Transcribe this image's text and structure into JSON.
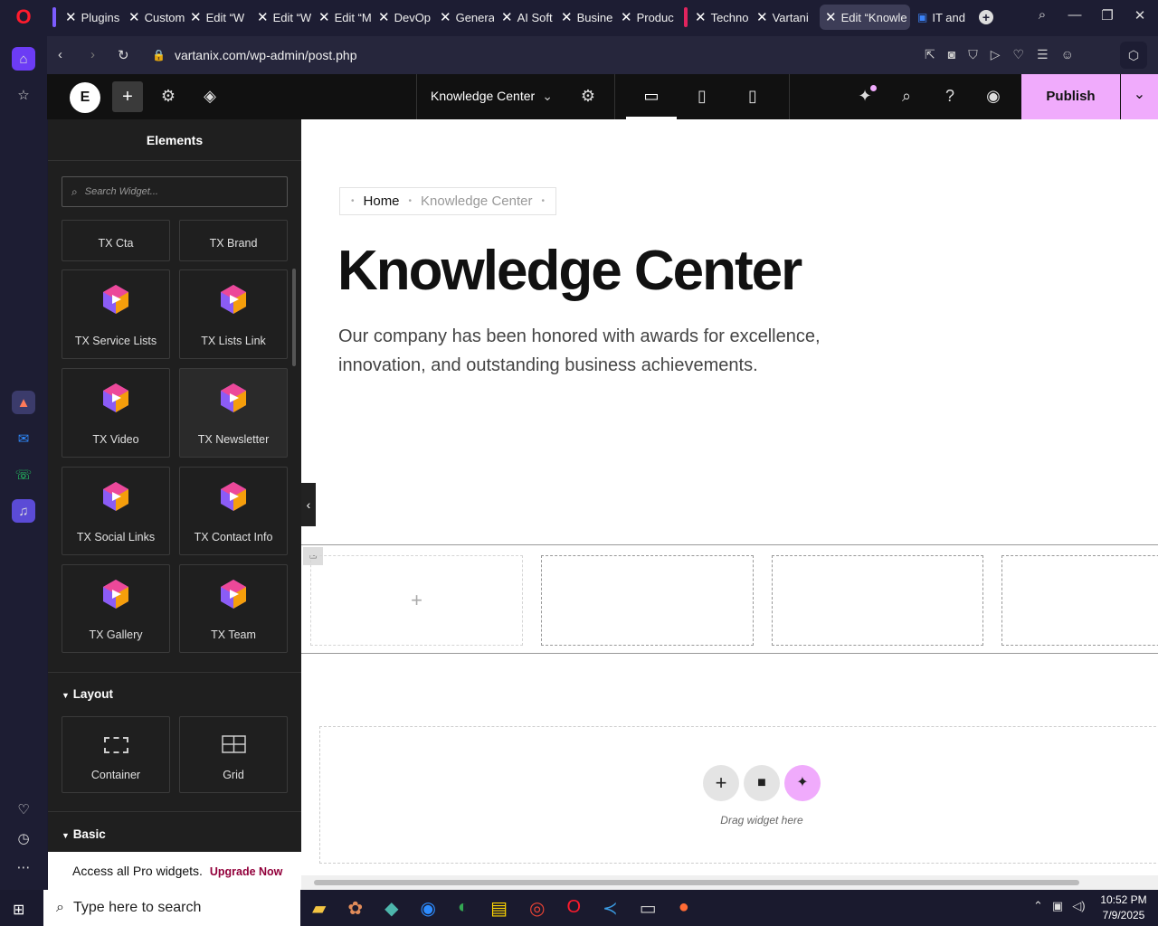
{
  "browser": {
    "tabs": [
      {
        "label": "Plugins"
      },
      {
        "label": "Custom"
      },
      {
        "label": "Edit “W"
      },
      {
        "label": "Edit “W"
      },
      {
        "label": "Edit “M"
      },
      {
        "label": "DevOp"
      },
      {
        "label": "Genera"
      },
      {
        "label": "AI Soft"
      },
      {
        "label": "Busine"
      },
      {
        "label": "Produc"
      },
      {
        "label": "Techno"
      },
      {
        "label": "Vartani"
      },
      {
        "label": "Edit “Knowle"
      },
      {
        "label": "IT and"
      }
    ],
    "url": "vartanix.com/wp-admin/post.php"
  },
  "editor": {
    "page_name": "Knowledge Center",
    "publish_label": "Publish"
  },
  "panel": {
    "title": "Elements",
    "search_placeholder": "Search Widget...",
    "widgets": [
      {
        "label": "TX Cta"
      },
      {
        "label": "TX Brand"
      },
      {
        "label": "TX Service Lists"
      },
      {
        "label": "TX Lists Link"
      },
      {
        "label": "TX Video"
      },
      {
        "label": "TX Newsletter"
      },
      {
        "label": "TX Social Links"
      },
      {
        "label": "TX Contact Info"
      },
      {
        "label": "TX Gallery"
      },
      {
        "label": "TX Team"
      }
    ],
    "layout_heading": "Layout",
    "layout_widgets": [
      {
        "label": "Container"
      },
      {
        "label": "Grid"
      }
    ],
    "basic_heading": "Basic",
    "promo_text": "Access all Pro widgets.",
    "promo_link": "Upgrade Now"
  },
  "canvas": {
    "breadcrumb": [
      "Home",
      "Knowledge Center"
    ],
    "heading": "Knowledge Center",
    "description": "Our company has been honored with awards for excellence, innovation, and outstanding business achievements.",
    "drag_text": "Drag widget here"
  },
  "taskbar": {
    "search_placeholder": "Type here to search",
    "time": "10:52 PM",
    "date": "7/9/2025"
  },
  "colors": {
    "accent": "#f0abfc",
    "panel_bg": "#1f1f1f",
    "topbar_bg": "#111111"
  }
}
